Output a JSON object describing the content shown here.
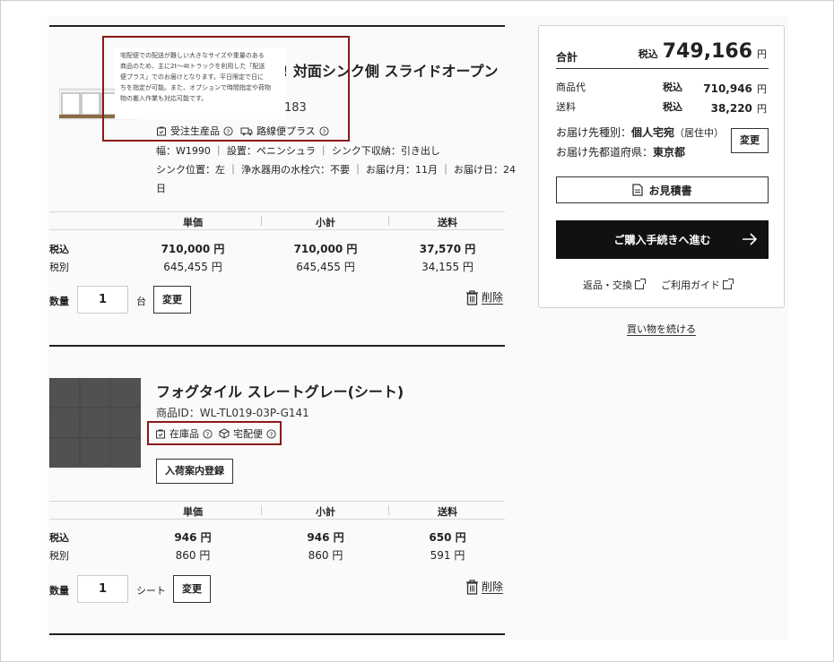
{
  "item1": {
    "title_visible": "! 対面シンク側 スライドオープン",
    "id_partial": "183",
    "tag_made_to_order": "受注生産品",
    "tag_delivery": "路線便プラス",
    "spec_line1": "幅：W1990 ｜ 設置：ペニンシュラ ｜ シンク下収納：引き出し",
    "spec_line2": "シンク位置：左 ｜ 浄水器用の水栓穴：不要 ｜ お届け月：11月 ｜ お届け日：24",
    "spec_line3": "日",
    "tooltip_lines": [
      "宅配便での配送が難しい大きなサイズや重量のある",
      "商品のため、主に2t〜4tトラックを利用した「配送",
      "便プラス」でのお届けとなります。平日限定で日に",
      "ちを指定が可能。また、オプションで時間指定や荷物",
      "物の搬入作業も対応可能です。"
    ],
    "head_unit": "単価",
    "head_subtotal": "小計",
    "head_shipping": "送料",
    "tax_in_label": "税込",
    "tax_ex_label": "税別",
    "unit_tax_in": "710,000 円",
    "unit_tax_ex": "645,455 円",
    "subtotal_tax_in": "710,000 円",
    "subtotal_tax_ex": "645,455 円",
    "shipping_tax_in": "37,570 円",
    "shipping_tax_ex": "34,155 円",
    "qty_label": "数量",
    "qty_value": "1",
    "qty_unit": "台",
    "change_label": "変更",
    "delete_label": "削除"
  },
  "item2": {
    "title": "フォグタイル スレートグレー(シート)",
    "product_id": "商品ID：WL-TL019-03P-G141",
    "tag_in_stock": "在庫品",
    "tag_delivery": "宅配便",
    "restock_button": "入荷案内登録",
    "head_unit": "単価",
    "head_subtotal": "小計",
    "head_shipping": "送料",
    "tax_in_label": "税込",
    "tax_ex_label": "税別",
    "unit_tax_in": "946 円",
    "unit_tax_ex": "860 円",
    "subtotal_tax_in": "946 円",
    "subtotal_tax_ex": "860 円",
    "shipping_tax_in": "650 円",
    "shipping_tax_ex": "591 円",
    "qty_label": "数量",
    "qty_value": "1",
    "qty_unit": "シート",
    "change_label": "変更",
    "delete_label": "削除"
  },
  "summary": {
    "total_label": "合計",
    "total_tax_label": "税込",
    "total_value": "749,166",
    "total_unit": "円",
    "goods_label": "商品代",
    "goods_tax": "税込",
    "goods_value": "710,946",
    "goods_unit": "円",
    "shipping_label": "送料",
    "shipping_tax": "税込",
    "shipping_value": "38,220",
    "shipping_unit": "円",
    "dest_type_label": "お届け先種別：",
    "dest_type_value": "個人宅宛",
    "dest_type_note": "（居住中）",
    "dest_pref_label": "お届け先都道府県：",
    "dest_pref_value": "東京都",
    "change_label": "変更",
    "quote_button": "お見積書",
    "checkout_button": "ご購入手続きへ進む",
    "returns_link": "返品・交換",
    "guide_link": "ご利用ガイド",
    "continue_link": "買い物を続ける"
  },
  "colors": {
    "highlight_border": "#8b1a1a",
    "checkout_bg": "#111111"
  }
}
